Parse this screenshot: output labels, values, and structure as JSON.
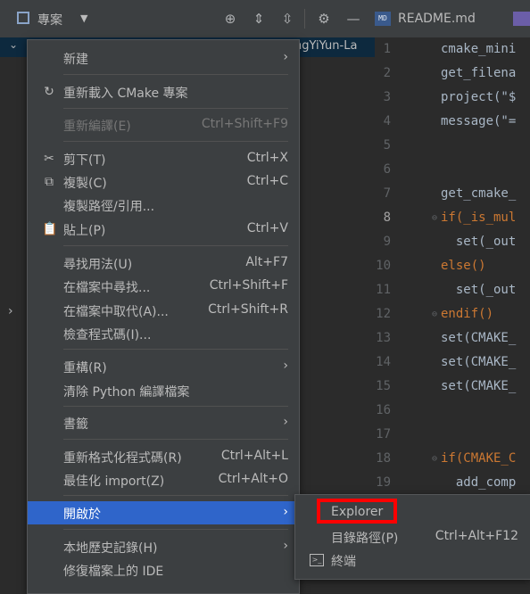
{
  "toolbar": {
    "project_label": "專案",
    "tab_readme": "README.md",
    "tab_readme_icon_text": "MD"
  },
  "tree": {
    "row_text": "ngYiYun-La"
  },
  "editor": {
    "lines": [
      {
        "n": "1",
        "t": "cmake_mini"
      },
      {
        "n": "2",
        "t": "get_filena"
      },
      {
        "n": "3",
        "t": "project(\"$"
      },
      {
        "n": "4",
        "t": "message(\"="
      },
      {
        "n": "5",
        "t": ""
      },
      {
        "n": "6",
        "t": ""
      },
      {
        "n": "7",
        "t": "get_cmake_"
      },
      {
        "n": "8",
        "t": "if(_is_mul"
      },
      {
        "n": "9",
        "t": "  set(_out"
      },
      {
        "n": "10",
        "t": "else()"
      },
      {
        "n": "11",
        "t": "  set(_out"
      },
      {
        "n": "12",
        "t": "endif()"
      },
      {
        "n": "13",
        "t": "set(CMAKE_"
      },
      {
        "n": "14",
        "t": "set(CMAKE_"
      },
      {
        "n": "15",
        "t": "set(CMAKE_"
      },
      {
        "n": "16",
        "t": ""
      },
      {
        "n": "17",
        "t": ""
      },
      {
        "n": "18",
        "t": "if(CMAKE_C"
      },
      {
        "n": "19",
        "t": "  add_comp"
      }
    ]
  },
  "menu": {
    "new": "新建",
    "reload_cmake": "重新載入 CMake 專案",
    "recompile": "重新編譯(E)",
    "recompile_sc": "Ctrl+Shift+F9",
    "cut": "剪下(T)",
    "cut_sc": "Ctrl+X",
    "copy": "複製(C)",
    "copy_sc": "Ctrl+C",
    "copy_path": "複製路徑/引用...",
    "paste": "貼上(P)",
    "paste_sc": "Ctrl+V",
    "find_usages": "尋找用法(U)",
    "find_usages_sc": "Alt+F7",
    "find_in_files": "在檔案中尋找...",
    "find_in_files_sc": "Ctrl+Shift+F",
    "replace_in_files": "在檔案中取代(A)...",
    "replace_in_files_sc": "Ctrl+Shift+R",
    "inspect_code": "檢查程式碼(I)...",
    "refactor": "重構(R)",
    "clean_python": "清除 Python 編譯檔案",
    "bookmarks": "書籤",
    "reformat": "重新格式化程式碼(R)",
    "reformat_sc": "Ctrl+Alt+L",
    "optimize_imports": "最佳化 import(Z)",
    "optimize_imports_sc": "Ctrl+Alt+O",
    "open_in": "開啟於",
    "local_history": "本地歷史記錄(H)",
    "repair_ide": "修復檔案上的 IDE"
  },
  "submenu": {
    "explorer": "Explorer",
    "dir_path": "目錄路徑(P)",
    "dir_path_sc": "Ctrl+Alt+F12",
    "terminal": "終端"
  },
  "colors": {
    "selected": "#2f65ca",
    "highlight_box": "#ff0000",
    "menu_bg": "#3c3f41",
    "editor_bg": "#2b2b2b"
  }
}
